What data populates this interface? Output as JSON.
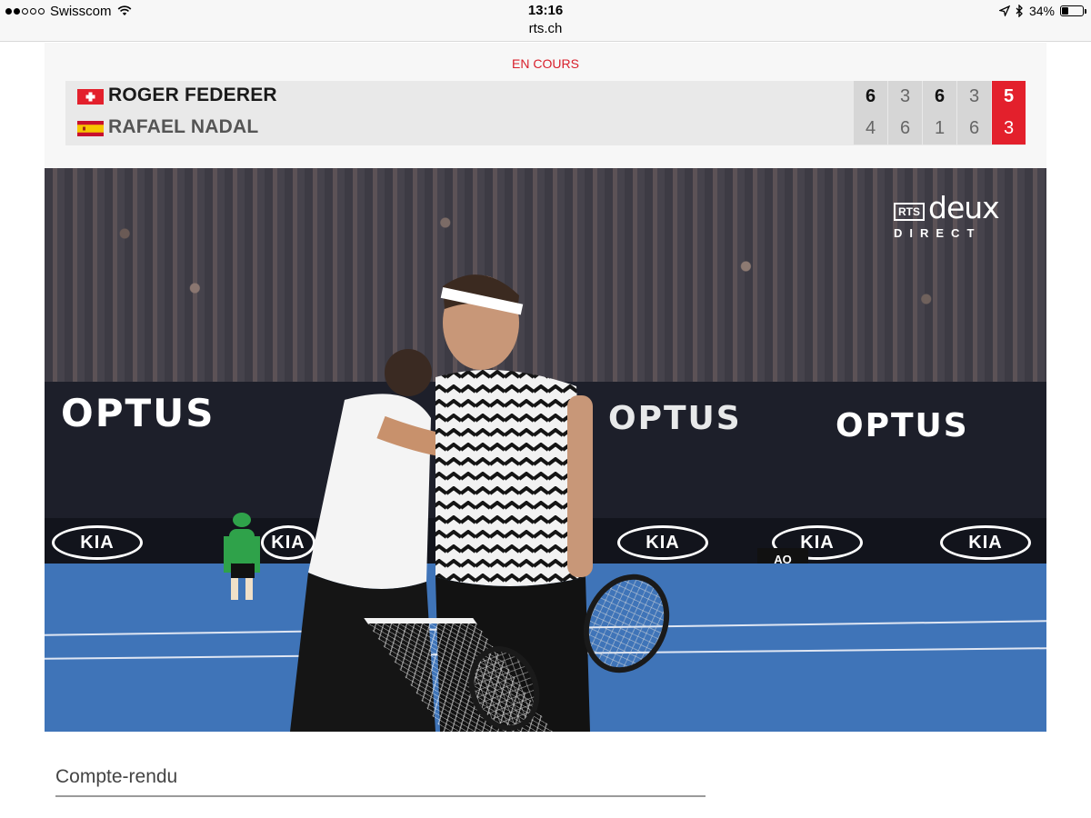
{
  "status_bar": {
    "carrier": "Swisscom",
    "time": "13:16",
    "url": "rts.ch",
    "battery_percent": "34%",
    "battery_level": 0.34,
    "signal_bars": 2,
    "icons": [
      "signal-dots-icon",
      "wifi-icon",
      "location-arrow-icon",
      "bluetooth-icon",
      "battery-icon"
    ]
  },
  "match": {
    "status": "EN COURS",
    "players": [
      {
        "name": "ROGER FEDERER",
        "flag": "switzerland-flag-icon",
        "sets": [
          "6",
          "3",
          "6",
          "3",
          "5"
        ]
      },
      {
        "name": "RAFAEL NADAL",
        "flag": "spain-flag-icon",
        "sets": [
          "4",
          "6",
          "1",
          "6",
          "3"
        ]
      }
    ]
  },
  "video": {
    "broadcaster_box": "RTS",
    "broadcaster_channel": "deux",
    "broadcaster_tag": "DIRECT",
    "sponsor_optus": "OPTUS",
    "sponsor_kia": "KIA",
    "event_logo": "AO"
  },
  "content": {
    "section_heading": "Compte-rendu"
  },
  "colors": {
    "accent_red": "#e3202c",
    "scoreboard_bg": "#e9e9e9",
    "page_bg": "#f7f7f7",
    "court_blue": "#3f74b8"
  }
}
